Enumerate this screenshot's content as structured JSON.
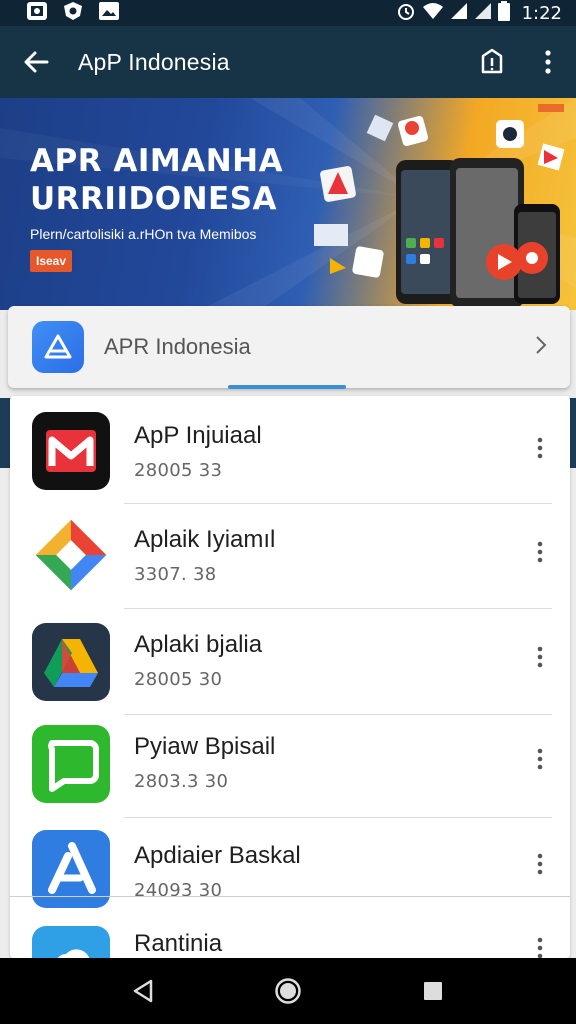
{
  "status_bar": {
    "time": "1:22",
    "left_icons": [
      "image-icon",
      "shield-icon",
      "photo-icon"
    ],
    "right_icons": [
      "alarm-icon",
      "wifi-icon",
      "signal-icon",
      "signal-icon",
      "battery-icon"
    ]
  },
  "app_bar": {
    "title": "ApP Indonesia",
    "icons": [
      "back-arrow-icon",
      "share-icon",
      "more-vert-icon"
    ]
  },
  "banner": {
    "headline_line1": "APR AIMANHA",
    "headline_line2": "URRIIDONESA",
    "subtitle": "Plern/cartolisiki a.rHOn tva Memibos",
    "badge": "Iseav"
  },
  "featured": {
    "label": "APR Indonesia",
    "icon": "app-store-icon"
  },
  "apps": [
    {
      "name": "ApP Injuiaal",
      "meta": "28005 33",
      "icon": "gmail-icon",
      "colors": [
        "#111111",
        "#e8333a"
      ]
    },
    {
      "name": "Aplaik Iyiamıl",
      "meta": "3307. 38",
      "icon": "multicolor-diamond-icon",
      "colors": [
        "#f2b230",
        "#34a853",
        "#4285f4",
        "#ea4335"
      ]
    },
    {
      "name": "Aplaki bjalia",
      "meta": "28005 30",
      "icon": "drive-icon",
      "colors": [
        "#263548",
        "#f4b400",
        "#0f9d58",
        "#ea4335"
      ]
    },
    {
      "name": "Pyiaw Bpisail",
      "meta": "2803.3 30",
      "icon": "chat-icon",
      "colors": [
        "#2eb82e"
      ]
    },
    {
      "name": "Apdiaier Baskal",
      "meta": "24093 30",
      "icon": "app-store-icon",
      "colors": [
        "#2f7de1"
      ]
    },
    {
      "name": "Rantinia",
      "meta": "",
      "icon": "cloud-icon",
      "colors": [
        "#2fa0e6"
      ]
    }
  ],
  "nav_bar": {
    "icons": [
      "back-triangle-icon",
      "home-circle-icon",
      "recents-square-icon"
    ]
  }
}
